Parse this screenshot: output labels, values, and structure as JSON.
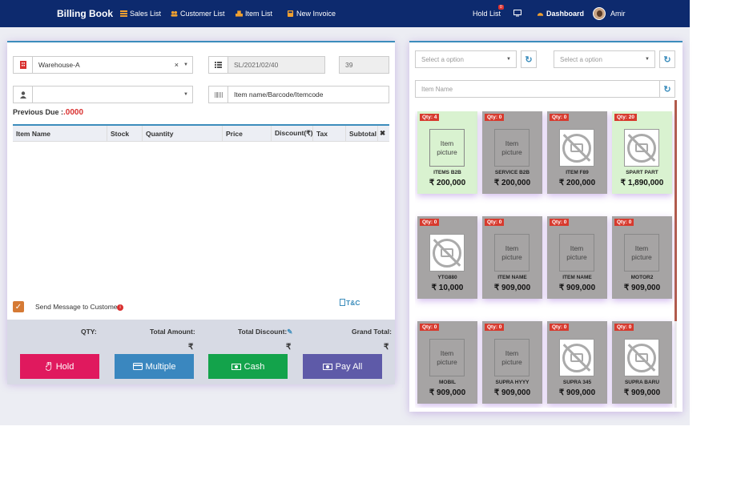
{
  "navbar": {
    "brand": "Billing Book",
    "links": [
      {
        "label": "Sales List",
        "icon": "list-icon"
      },
      {
        "label": "Customer List",
        "icon": "users-icon"
      },
      {
        "label": "Item List",
        "icon": "cubes-icon"
      },
      {
        "label": "New Invoice",
        "icon": "calculator-icon"
      }
    ],
    "hold_list_label": "Hold List",
    "hold_list_count": "0",
    "dashboard_label": "Dashboard",
    "user_name": "Amir",
    "bar_color": "#0d2a6e"
  },
  "invoice": {
    "warehouse": "Warehouse-A",
    "warehouse_clear": "×",
    "invoice_code": "SL/2021/02/40",
    "invoice_number": "39",
    "customer": "",
    "item_search_placeholder": "Item name/Barcode/Itemcode",
    "previous_due_label": "Previous Due :",
    "previous_due_value": ".0000",
    "columns": [
      "Item Name",
      "Stock",
      "Quantity",
      "Price",
      "Discount(₹)",
      "Tax",
      "Subtotal"
    ],
    "remove_all_icon": "✖",
    "send_message_label": "Send Message to Customer",
    "tnc_label": "T&C"
  },
  "summary": {
    "qty_label": "QTY:",
    "total_amount_label": "Total Amount:",
    "total_discount_label": "Total Discount:",
    "grand_total_label": "Grand Total:",
    "currency_symbol": "₹"
  },
  "actions": [
    {
      "label": "Hold",
      "color": "#e0195e",
      "icon": "hand-icon"
    },
    {
      "label": "Multiple",
      "color": "#3a87bf",
      "icon": "credit-card-icon"
    },
    {
      "label": "Cash",
      "color": "#13a34b",
      "icon": "money-icon"
    },
    {
      "label": "Pay All",
      "color": "#5e5aa8",
      "icon": "money-icon"
    }
  ],
  "filters": {
    "category_placeholder": "Select a option",
    "brand_placeholder": "Select a option",
    "item_name_placeholder": "Item Name"
  },
  "items": [
    {
      "qty": "Qty: 4",
      "name": "ITEMS B2B",
      "price": "₹ 200,000",
      "in_stock": true,
      "image": "placeholder"
    },
    {
      "qty": "Qty: 0",
      "name": "SERVICE B2B",
      "price": "₹ 200,000",
      "in_stock": false,
      "image": "placeholder"
    },
    {
      "qty": "Qty: 0",
      "name": "ITEM F89",
      "price": "₹ 200,000",
      "in_stock": false,
      "image": "no-image"
    },
    {
      "qty": "Qty: 20",
      "name": "SPART PART",
      "price": "₹ 1,890,000",
      "in_stock": true,
      "image": "no-image"
    },
    {
      "qty": "Qty: 0",
      "name": "YTG880",
      "price": "₹ 10,000",
      "in_stock": false,
      "image": "no-image"
    },
    {
      "qty": "Qty: 0",
      "name": "ITEM NAME",
      "price": "₹ 909,000",
      "in_stock": false,
      "image": "placeholder"
    },
    {
      "qty": "Qty: 0",
      "name": "ITEM NAME",
      "price": "₹ 909,000",
      "in_stock": false,
      "image": "placeholder"
    },
    {
      "qty": "Qty: 0",
      "name": "MOTOR2",
      "price": "₹ 909,000",
      "in_stock": false,
      "image": "placeholder"
    },
    {
      "qty": "Qty: 0",
      "name": "MOBIL",
      "price": "₹ 909,000",
      "in_stock": false,
      "image": "placeholder"
    },
    {
      "qty": "Qty: 0",
      "name": "SUPRA HYYY",
      "price": "₹ 909,000",
      "in_stock": false,
      "image": "placeholder"
    },
    {
      "qty": "Qty: 0",
      "name": "SUPRA 345",
      "price": "₹ 909,000",
      "in_stock": false,
      "image": "no-image"
    },
    {
      "qty": "Qty: 0",
      "name": "SUPRA BARU",
      "price": "₹ 909,000",
      "in_stock": false,
      "image": "no-image"
    }
  ],
  "item_picture_alt": "Item picture"
}
